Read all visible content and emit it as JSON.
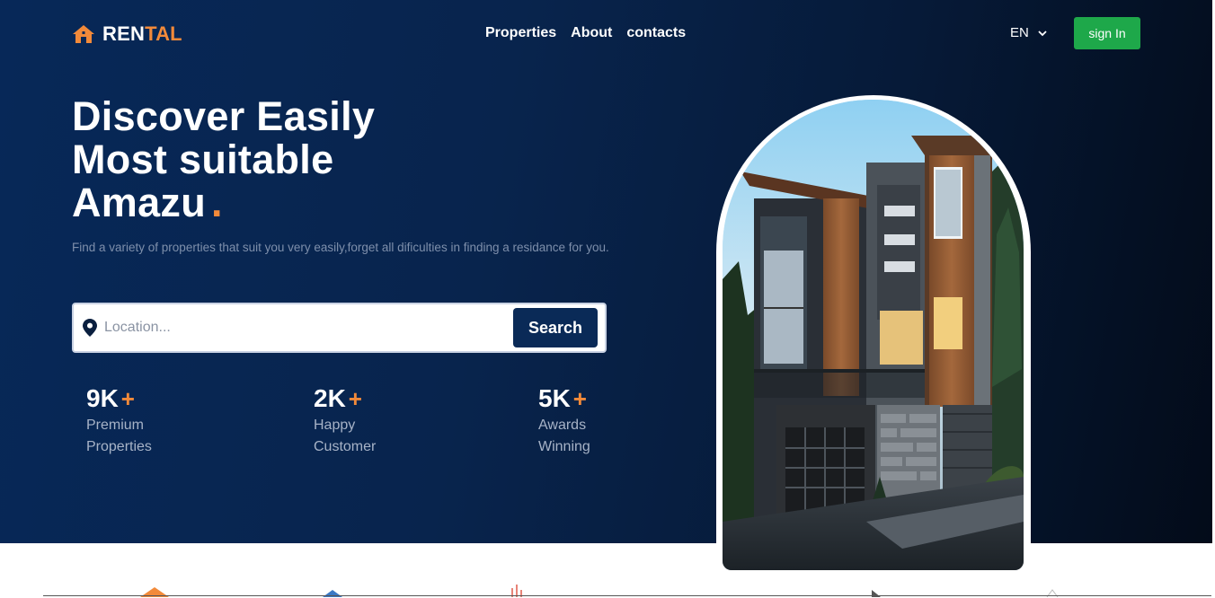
{
  "nav": {
    "logo": {
      "part1": "REN",
      "part2": "TAL",
      "icon": "house-icon"
    },
    "links": [
      "Properties",
      "About",
      "contacts"
    ],
    "language": "EN",
    "signin_label": "sign In"
  },
  "hero": {
    "title_lines": [
      "Discover Easily",
      "Most suitable",
      "Amazu"
    ],
    "title_dot": ".",
    "subtitle": "Find a variety of properties that suit you very easily,forget all dificulties in finding a residance for you.",
    "search": {
      "placeholder": "Location...",
      "button_label": "Search",
      "icon": "map-pin-icon"
    },
    "stats": [
      {
        "value": "9K",
        "plus": "+",
        "label_line1": "Premium",
        "label_line2": "Properties"
      },
      {
        "value": "2K",
        "plus": "+",
        "label_line1": "Happy",
        "label_line2": "Customer"
      },
      {
        "value": "5K",
        "plus": "+",
        "label_line1": "Awards",
        "label_line2": "Winning"
      }
    ]
  },
  "colors": {
    "accent": "#f28a3a",
    "navy": "#0a2a57",
    "signin_green": "#1ea84a"
  }
}
